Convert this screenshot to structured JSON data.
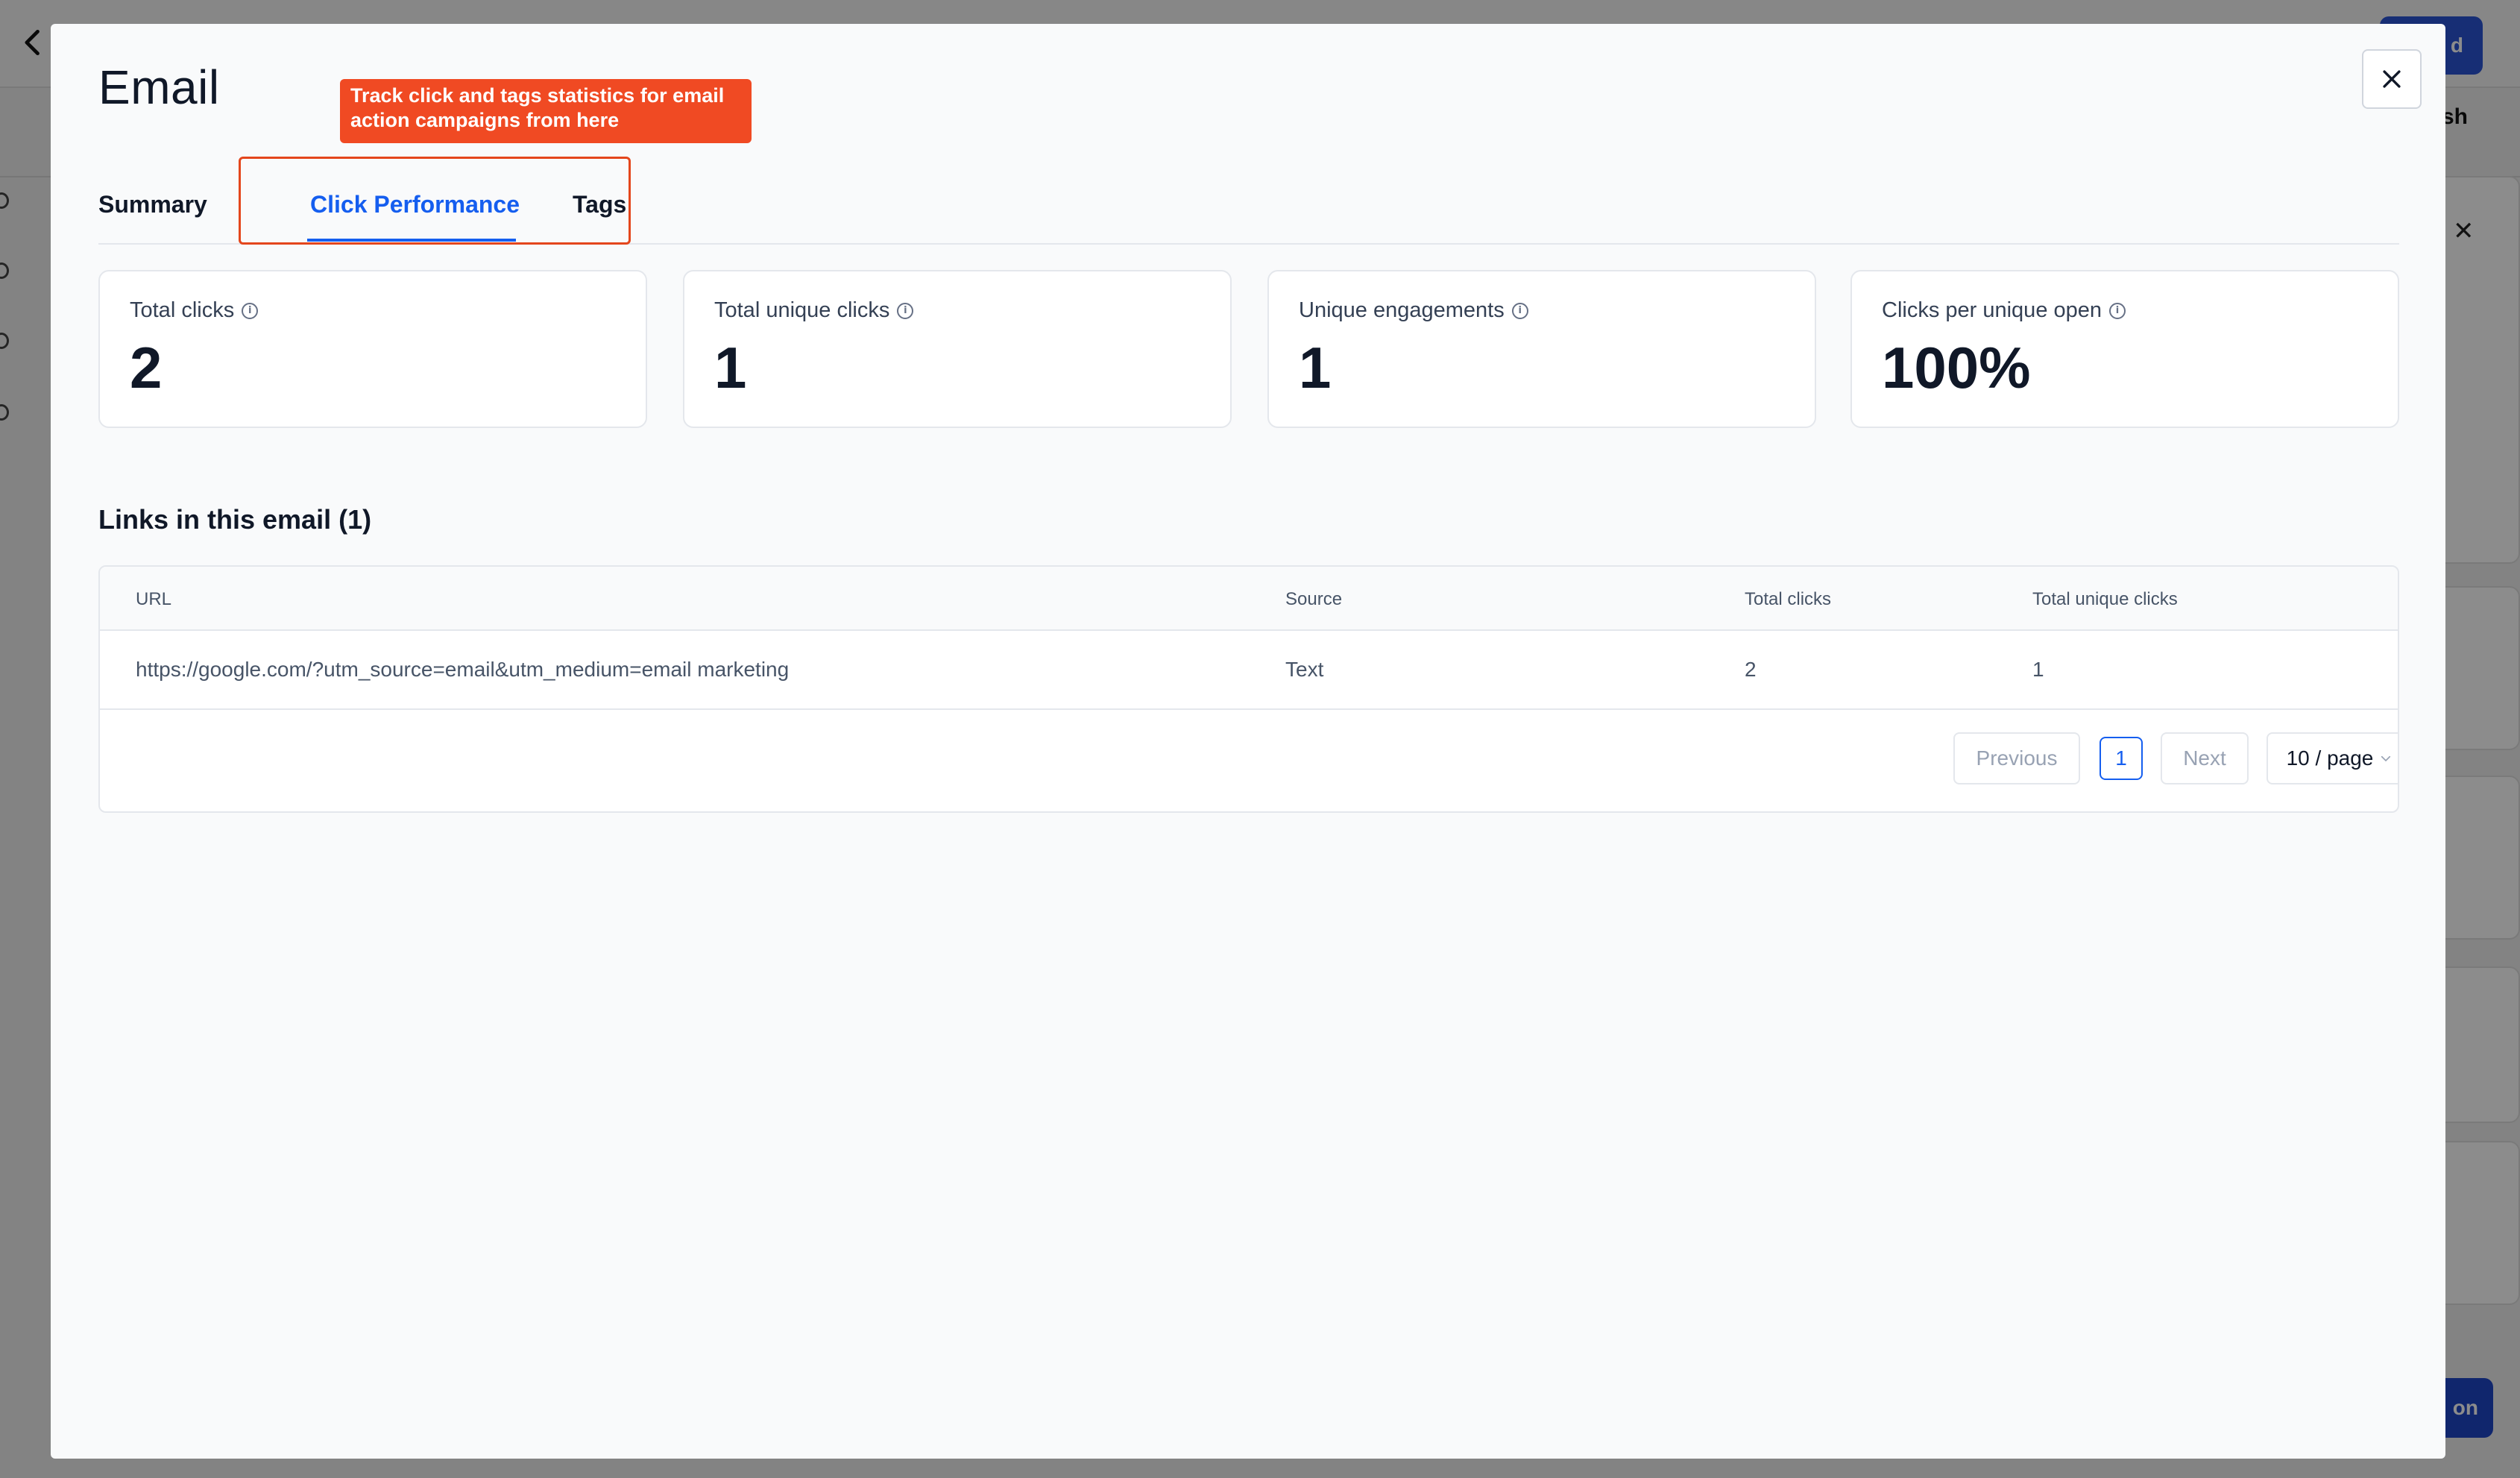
{
  "background": {
    "top_button_label": "d",
    "publish_label": "blish",
    "bottom_button_label": "on",
    "panel_close": "✕"
  },
  "modal": {
    "title": "Email",
    "callout_text": "Track click and tags statistics for email action campaigns from here",
    "tabs": [
      {
        "label": "Summary",
        "active": false
      },
      {
        "label": "Click Performance",
        "active": true
      },
      {
        "label": "Tags",
        "active": false
      }
    ],
    "stats": [
      {
        "label": "Total clicks",
        "value": "2"
      },
      {
        "label": "Total unique clicks",
        "value": "1"
      },
      {
        "label": "Unique engagements",
        "value": "1"
      },
      {
        "label": "Clicks per unique open",
        "value": "100%"
      }
    ],
    "links_heading": "Links in this email (1)",
    "table": {
      "columns": [
        "URL",
        "Source",
        "Total clicks",
        "Total unique clicks"
      ],
      "rows": [
        [
          "https://google.com/?utm_source=email&utm_medium=email marketing",
          "Text",
          "2",
          "1"
        ]
      ]
    },
    "pagination": {
      "previous_label": "Previous",
      "current_page": "1",
      "next_label": "Next",
      "page_size_label": "10 / page"
    }
  },
  "colors": {
    "accent": "#155eef",
    "callout": "#f04a23",
    "text_primary": "#101828"
  }
}
